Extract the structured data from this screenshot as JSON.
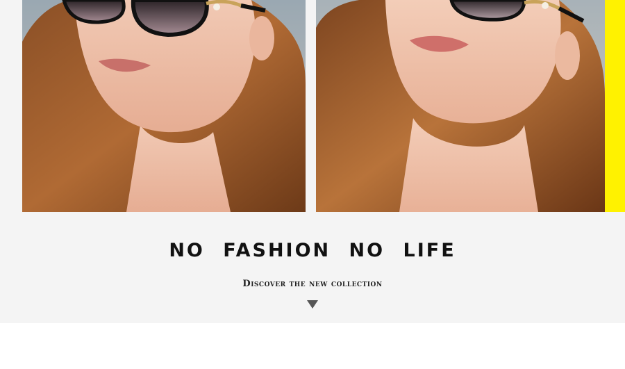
{
  "banner": {
    "headline": "NO FASHION NO LIFE",
    "subline": "Discover the new collection",
    "background_color": "#f4f4f4",
    "accent_color": "#fff200"
  },
  "photos": [
    {
      "name": "model-photo-left",
      "description_icon": "sunglasses-model-photo"
    },
    {
      "name": "model-photo-right",
      "description_icon": "sunglasses-model-photo"
    }
  ],
  "scroll_indicator": {
    "icon": "triangle-down-icon",
    "color": "#555555"
  }
}
